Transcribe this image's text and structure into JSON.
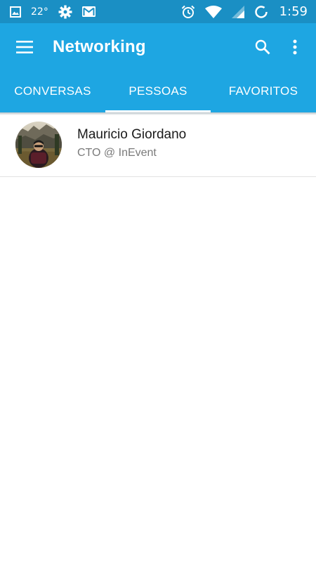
{
  "status_bar": {
    "temperature": "22°",
    "time": "1:59",
    "icons": [
      "image-icon",
      "settings-icon",
      "gmail-icon",
      "alarm-icon",
      "wifi-icon",
      "signal-icon",
      "battery-saver-icon"
    ]
  },
  "app_bar": {
    "title": "Networking",
    "icons": [
      "menu-icon",
      "search-icon",
      "more-vert-icon"
    ]
  },
  "tabs": [
    {
      "label": "CONVERSAS",
      "selected": false
    },
    {
      "label": "PESSOAS",
      "selected": true
    },
    {
      "label": "FAVORITOS",
      "selected": false
    }
  ],
  "people": [
    {
      "name": "Mauricio Giordano",
      "role": "CTO @ InEvent"
    }
  ],
  "colors": {
    "status_bar": "#1a8fc4",
    "primary": "#1ea6e2",
    "indicator": "#ffffff",
    "background": "#ffffff"
  }
}
